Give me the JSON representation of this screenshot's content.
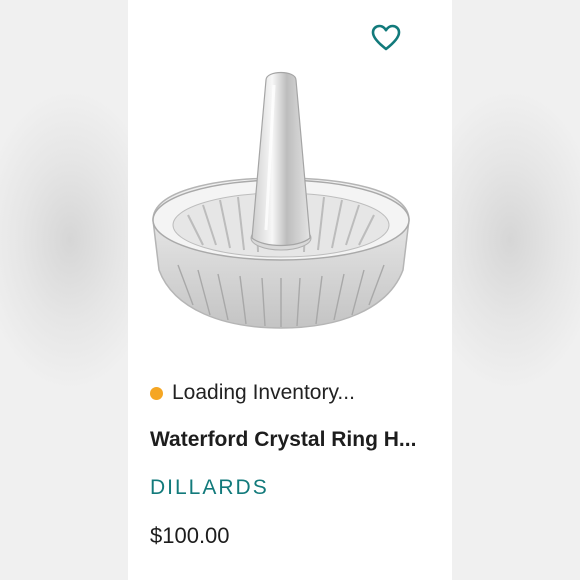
{
  "listing": {
    "status_text": "Loading Inventory...",
    "title": "Waterford Crystal Ring H...",
    "brand": "DILLARDS",
    "price": "$100.00"
  },
  "icons": {
    "like": "heart-outline-icon",
    "status": "status-dot-icon"
  },
  "colors": {
    "accent": "#127a7b",
    "status_dot": "#f5a623",
    "text": "#1d1d1d"
  }
}
